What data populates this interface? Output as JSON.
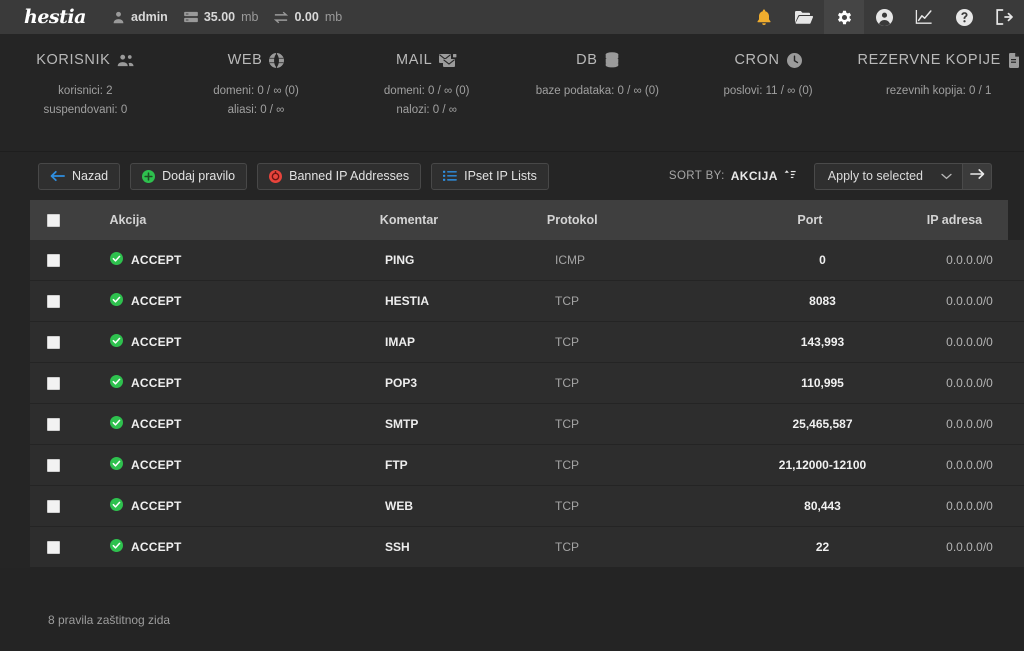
{
  "topbar": {
    "logo": "hestia",
    "user": "admin",
    "user_icon": "user-icon",
    "disk": {
      "value": "35.00",
      "unit": "mb",
      "icon": "server-icon"
    },
    "bandwidth": {
      "value": "0.00",
      "unit": "mb",
      "icon": "transfer-icon"
    },
    "icons": [
      {
        "name": "notifications-icon",
        "glyph": "bell",
        "color": "#f0ad2e",
        "active": false
      },
      {
        "name": "files-icon",
        "glyph": "folder",
        "color": "#e6e6e6",
        "active": false
      },
      {
        "name": "settings-icon",
        "glyph": "gear",
        "color": "#ffffff",
        "active": true
      },
      {
        "name": "account-icon",
        "glyph": "user-circle",
        "color": "#e6e6e6",
        "active": false
      },
      {
        "name": "statistics-icon",
        "glyph": "chart",
        "color": "#e6e6e6",
        "active": false
      },
      {
        "name": "help-icon",
        "glyph": "question-circle",
        "color": "#e6e6e6",
        "active": false
      },
      {
        "name": "logout-icon",
        "glyph": "logout",
        "color": "#e6e6e6",
        "active": false
      }
    ]
  },
  "stats": [
    {
      "title": "KORISNIK",
      "icon": "users-icon",
      "lines": [
        "korisnici: 2",
        "suspendovani: 0"
      ]
    },
    {
      "title": "WEB",
      "icon": "globe-icon",
      "lines": [
        "domeni: 0 / ∞ (0)",
        "aliasi: 0 / ∞"
      ]
    },
    {
      "title": "MAIL",
      "icon": "mail-icon",
      "lines": [
        "domeni: 0 / ∞ (0)",
        "nalozi: 0 / ∞"
      ]
    },
    {
      "title": "DB",
      "icon": "database-icon",
      "lines": [
        "baze podataka: 0 / ∞ (0)"
      ]
    },
    {
      "title": "CRON",
      "icon": "clock-icon",
      "lines": [
        "poslovi: 11 / ∞ (0)"
      ]
    },
    {
      "title": "REZERVNE KOPIJE",
      "icon": "backup-icon",
      "lines": [
        "rezevnih kopija: 0 / 1"
      ]
    }
  ],
  "toolbar": {
    "buttons": [
      {
        "label": "Nazad",
        "icon": "arrow-left-icon",
        "color": "#2f8fe0"
      },
      {
        "label": "Dodaj pravilo",
        "icon": "plus-circle-icon",
        "color": "#2ec14e"
      },
      {
        "label": "Banned IP Addresses",
        "icon": "ban-icon",
        "color": "#e8443c"
      },
      {
        "label": "IPset IP Lists",
        "icon": "list-icon",
        "color": "#2f8fe0"
      }
    ],
    "sort_label": "SORT BY:",
    "sort_value": "AKCIJA",
    "sort_icon": "sort-icon",
    "apply_label": "Apply to selected",
    "apply_chevron": "chevron-down-icon",
    "apply_go_icon": "arrow-right-icon"
  },
  "table": {
    "select_all_checkbox": "checkbox-unchecked",
    "columns": [
      "Akcija",
      "Komentar",
      "Protokol",
      "Port",
      "IP adresa"
    ],
    "rows": [
      {
        "checkbox": "checkbox-unchecked",
        "status_icon": "check-circle-icon",
        "akcija": "ACCEPT",
        "komentar": "PING",
        "protokol": "ICMP",
        "port": "0",
        "ip": "0.0.0.0/0"
      },
      {
        "checkbox": "checkbox-unchecked",
        "status_icon": "check-circle-icon",
        "akcija": "ACCEPT",
        "komentar": "HESTIA",
        "protokol": "TCP",
        "port": "8083",
        "ip": "0.0.0.0/0"
      },
      {
        "checkbox": "checkbox-unchecked",
        "status_icon": "check-circle-icon",
        "akcija": "ACCEPT",
        "komentar": "IMAP",
        "protokol": "TCP",
        "port": "143,993",
        "ip": "0.0.0.0/0"
      },
      {
        "checkbox": "checkbox-unchecked",
        "status_icon": "check-circle-icon",
        "akcija": "ACCEPT",
        "komentar": "POP3",
        "protokol": "TCP",
        "port": "110,995",
        "ip": "0.0.0.0/0"
      },
      {
        "checkbox": "checkbox-unchecked",
        "status_icon": "check-circle-icon",
        "akcija": "ACCEPT",
        "komentar": "SMTP",
        "protokol": "TCP",
        "port": "25,465,587",
        "ip": "0.0.0.0/0"
      },
      {
        "checkbox": "checkbox-unchecked",
        "status_icon": "check-circle-icon",
        "akcija": "ACCEPT",
        "komentar": "FTP",
        "protokol": "TCP",
        "port": "21,12000-12100",
        "ip": "0.0.0.0/0"
      },
      {
        "checkbox": "checkbox-unchecked",
        "status_icon": "check-circle-icon",
        "akcija": "ACCEPT",
        "komentar": "WEB",
        "protokol": "TCP",
        "port": "80,443",
        "ip": "0.0.0.0/0"
      },
      {
        "checkbox": "checkbox-unchecked",
        "status_icon": "check-circle-icon",
        "akcija": "ACCEPT",
        "komentar": "SSH",
        "protokol": "TCP",
        "port": "22",
        "ip": "0.0.0.0/0"
      }
    ]
  },
  "footer": {
    "text": "8 pravila zaštitnog zida"
  },
  "colors": {
    "accent_green": "#2ec14e",
    "accent_blue": "#2f8fe0",
    "accent_red": "#e8443c",
    "accent_yellow": "#f0ad2e",
    "bg_page": "#242424",
    "bg_panel": "#252525",
    "bg_topbar": "#3a3a3a",
    "bg_table_header": "#3f3f3f",
    "bg_row": "#2d2d2d"
  }
}
